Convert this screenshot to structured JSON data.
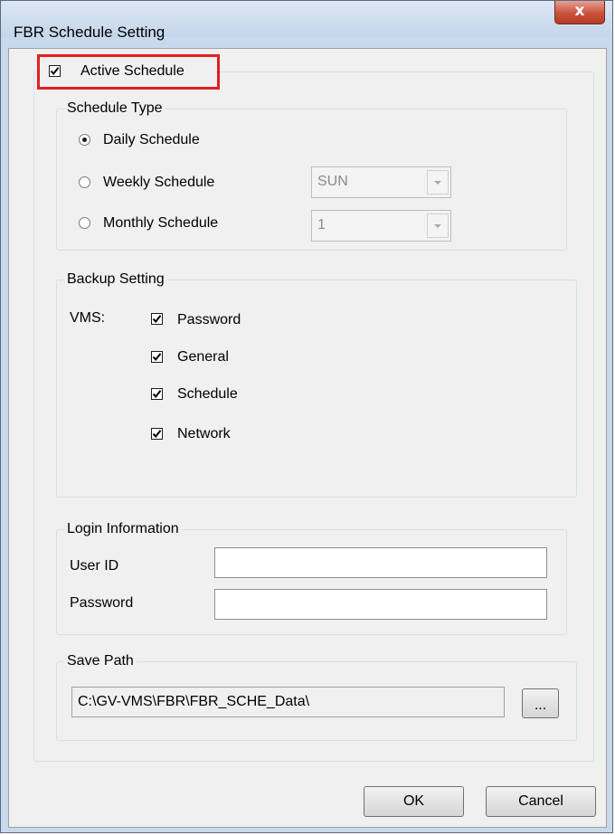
{
  "window": {
    "title": "FBR Schedule Setting",
    "close_symbol": "x"
  },
  "active_schedule": {
    "label": "Active Schedule",
    "checked": true
  },
  "schedule_type": {
    "legend": "Schedule Type",
    "options": [
      {
        "label": "Daily Schedule",
        "selected": true
      },
      {
        "label": "Weekly Schedule",
        "selected": false,
        "combo_value": "SUN"
      },
      {
        "label": "Monthly Schedule",
        "selected": false,
        "combo_value": "1"
      }
    ]
  },
  "backup_setting": {
    "legend": "Backup Setting",
    "vms_label": "VMS:",
    "items": [
      {
        "label": "Password",
        "checked": true
      },
      {
        "label": "General",
        "checked": true
      },
      {
        "label": "Schedule",
        "checked": true
      },
      {
        "label": "Network",
        "checked": true
      }
    ]
  },
  "login_information": {
    "legend": "Login Information",
    "user_id_label": "User ID",
    "user_id_value": "",
    "password_label": "Password",
    "password_value": ""
  },
  "save_path": {
    "legend": "Save Path",
    "value": "C:\\GV-VMS\\FBR\\FBR_SCHE_Data\\",
    "browse_label": "..."
  },
  "buttons": {
    "ok": "OK",
    "cancel": "Cancel"
  }
}
